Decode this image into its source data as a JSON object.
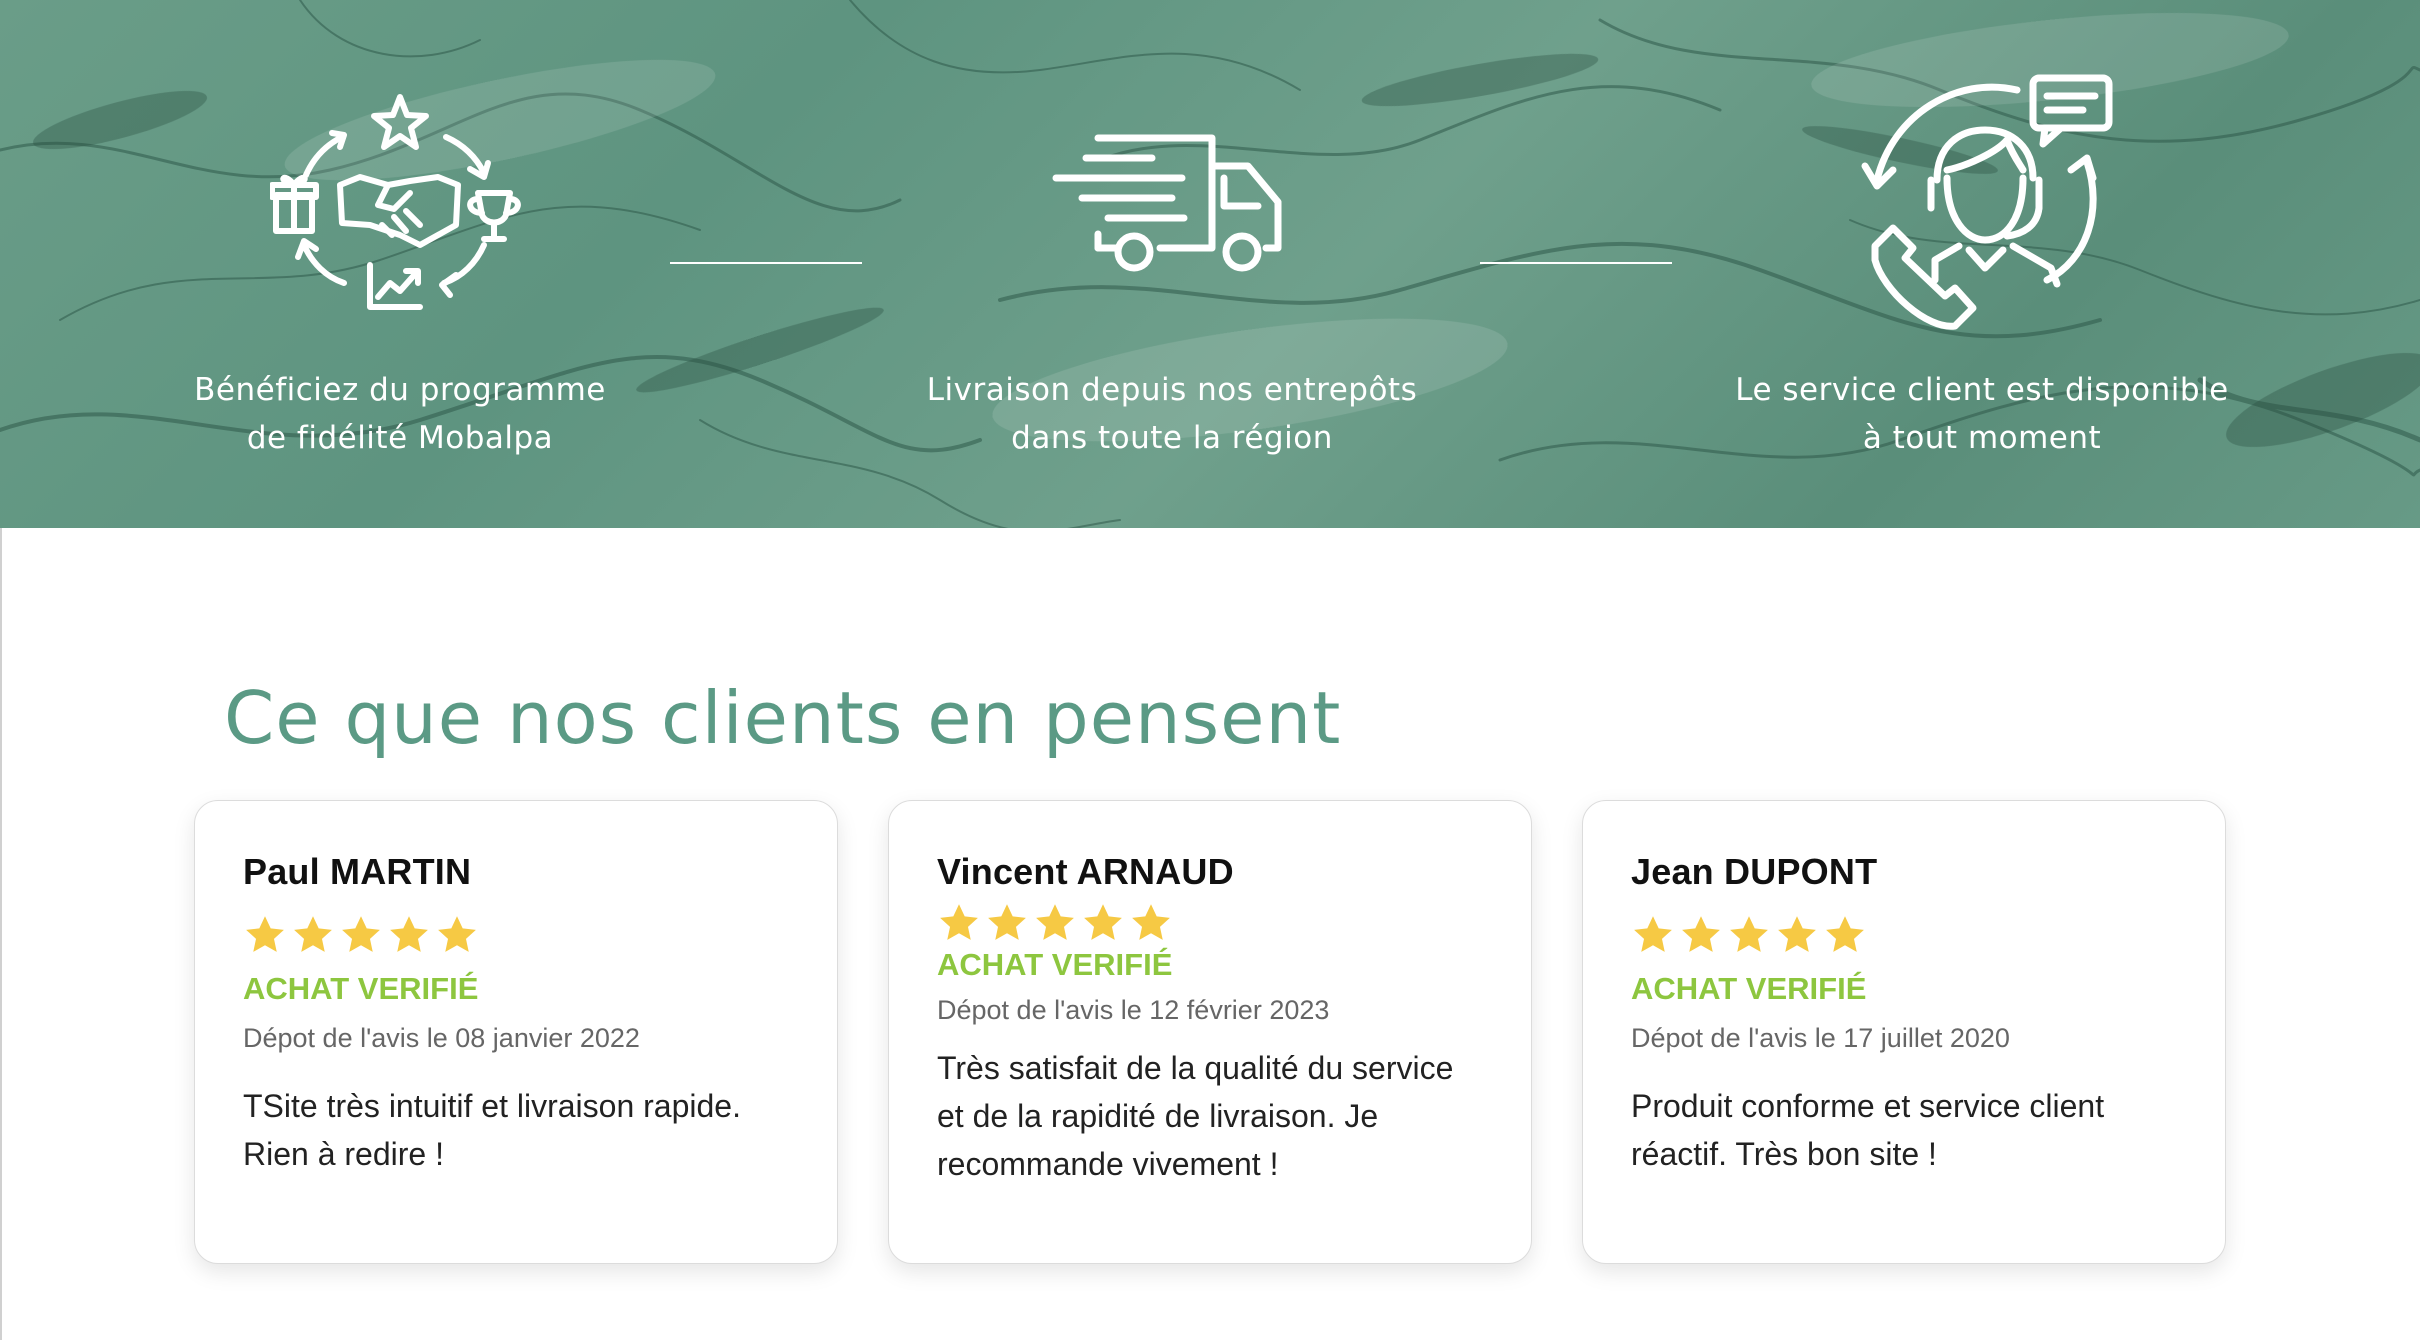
{
  "features": [
    {
      "icon": "loyalty-program-icon",
      "label": "Bénéficiez du programme\nde fidélité Mobalpa"
    },
    {
      "icon": "delivery-truck-icon",
      "label": "Livraison depuis nos entrepôts\ndans toute la région"
    },
    {
      "icon": "customer-service-icon",
      "label": "Le service client est disponible\nà tout moment"
    }
  ],
  "reviews": {
    "title": "Ce que nos clients en pensent",
    "items": [
      {
        "name": "Paul MARTIN",
        "rating": 5,
        "verified": "ACHAT VERIFIÉ",
        "date": "Dépot de l'avis le 08 janvier 2022",
        "text": "TSite très intuitif et livraison rapide. Rien à redire !"
      },
      {
        "name": "Vincent ARNAUD",
        "rating": 5,
        "verified": "ACHAT VERIFIÉ",
        "date": "Dépot de l'avis le 12 février 2023",
        "text": "Très satisfait de la qualité du service et de la rapidité de livraison. Je recommande vivement !"
      },
      {
        "name": "Jean DUPONT",
        "rating": 5,
        "verified": "ACHAT VERIFIÉ",
        "date": "Dépot de l'avis le 17 juillet 2020",
        "text": "Produit conforme et service client réactif. Très bon site !"
      }
    ]
  },
  "colors": {
    "banner_green": "#6a9d88",
    "title_green": "#5b9a85",
    "verified_green": "#8dc63f",
    "star_yellow": "#f6c944"
  }
}
